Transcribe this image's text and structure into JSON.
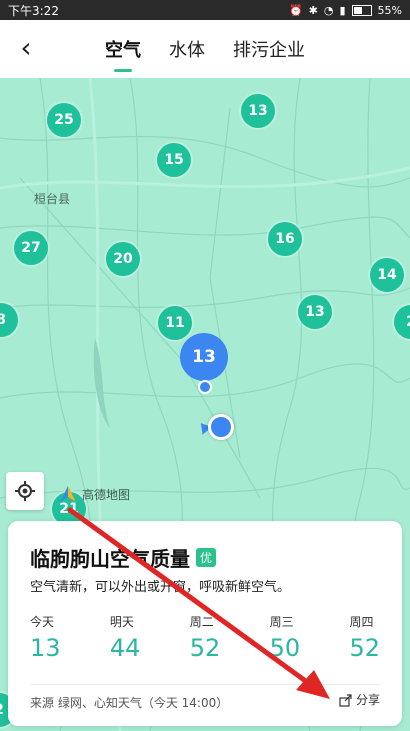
{
  "status": {
    "time": "下午3:22",
    "battery": "55%"
  },
  "nav": {
    "back_icon": "chevron-left-icon",
    "tabs": [
      {
        "label": "空气",
        "active": true
      },
      {
        "label": "水体",
        "active": false
      },
      {
        "label": "排污企业",
        "active": false
      }
    ]
  },
  "map": {
    "markers": [
      "25",
      "13",
      "15",
      "27",
      "20",
      "16",
      "14",
      "8",
      "11",
      "13",
      "2",
      "21",
      "2"
    ],
    "selected_marker": "13",
    "place_label": "桓台县",
    "provider": "高德地图"
  },
  "card": {
    "title": "临朐朐山空气质量",
    "badge": "优",
    "description": "空气清新，可以外出或开窗，呼吸新鲜空气。",
    "forecast": [
      {
        "day": "今天",
        "value": "13"
      },
      {
        "day": "明天",
        "value": "44"
      },
      {
        "day": "周二",
        "value": "52"
      },
      {
        "day": "周三",
        "value": "50"
      },
      {
        "day": "周四",
        "value": "52"
      }
    ],
    "source": "来源 绿网、心知天气（今天 14:00）",
    "share_label": "分享"
  },
  "colors": {
    "accent": "#2bc18b",
    "marker": "#1ec19a",
    "selected": "#3b86f0",
    "map_bg": "#a7ebd3"
  }
}
